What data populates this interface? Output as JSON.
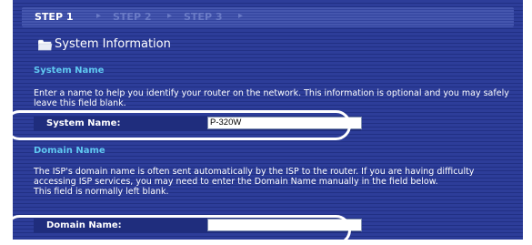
{
  "steps": {
    "step1": "STEP 1",
    "step2": "STEP 2",
    "step3": "STEP 3",
    "arrow": "▸"
  },
  "page": {
    "title": "System Information",
    "icon": "folder-icon"
  },
  "system_name_section": {
    "heading": "System Name",
    "description": "Enter a name to help you identify your router on the network. This information is optional and you may safely leave this field blank.",
    "field_label": "System Name:",
    "field_value": "P-320W"
  },
  "domain_name_section": {
    "heading": "Domain Name",
    "description_line1": "The ISP's domain name is often sent automatically by the ISP to the router. If you are having difficulty accessing ISP services, you may need to enter the Domain Name manually in the field below.",
    "description_line2": "This field is normally left blank.",
    "field_label": "Domain Name:",
    "field_value": ""
  },
  "colors": {
    "background": "#27368f",
    "section_heading": "#5fc8f0",
    "text": "#ffffff"
  }
}
